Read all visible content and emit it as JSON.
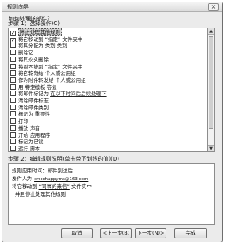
{
  "window": {
    "title": "规则向导",
    "close_glyph": "×"
  },
  "question": "如何处理该邮件？",
  "step1": {
    "label": "步骤 1：选择操作(C)"
  },
  "rules": [
    {
      "checked": true,
      "text": "停止处理其他规则",
      "selected": true
    },
    {
      "checked": true,
      "text": "将它移动到 “指定” 文件夹中"
    },
    {
      "checked": false,
      "text": "将其分配为 类别 类别"
    },
    {
      "checked": false,
      "text": "删除它"
    },
    {
      "checked": false,
      "text": "将其永久删除"
    },
    {
      "checked": false,
      "text": "将副本移到 “指定” 文件夹中"
    },
    {
      "checked": false,
      "text": "将它转寄给",
      "link": "个人或公用组"
    },
    {
      "checked": false,
      "text": "作为附件转发给",
      "link": "个人或公用组"
    },
    {
      "checked": false,
      "text": "用 特定模板 答复"
    },
    {
      "checked": false,
      "text": "将邮件标记为",
      "link": "在以下时间后后续处理下"
    },
    {
      "checked": false,
      "text": "清除邮件标志"
    },
    {
      "checked": false,
      "text": "清除邮件类别"
    },
    {
      "checked": false,
      "text": "标记为 重要性"
    },
    {
      "checked": false,
      "text": "打印"
    },
    {
      "checked": false,
      "text": "播放 声音"
    },
    {
      "checked": false,
      "text": "开始 应用程序"
    },
    {
      "checked": false,
      "text": "标记为已读"
    },
    {
      "checked": false,
      "text": "运行 脚本"
    }
  ],
  "step2": {
    "label": "步骤 2：编辑规则说明(单击带下划线的值)(D)",
    "lines": [
      {
        "text": "规则应用时间：邮件到达后"
      },
      {
        "prefix": "发件人为",
        "email": "cmcchappyms@163.com"
      },
      {
        "prefix": "将它移动到",
        "link": "“同事的来信”",
        "suffix": "文件夹中"
      },
      {
        "text": "并且停止处理其他规则",
        "indent": true
      }
    ]
  },
  "buttons": {
    "cancel": "取消",
    "back": "<上一步(B)",
    "next": "下一步(N)>",
    "finish": "完成"
  }
}
